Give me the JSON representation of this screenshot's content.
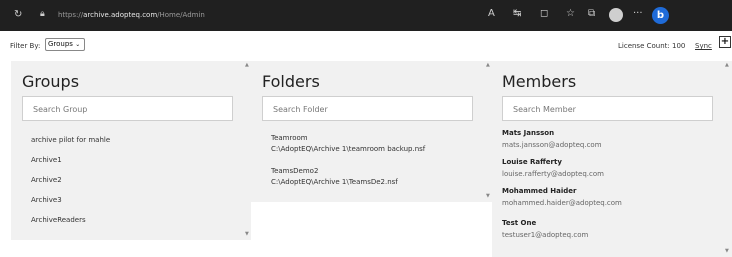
{
  "browser": {
    "url_prefix": "https://",
    "url_host": "archive.adopteq.com",
    "url_path": "/Home/Admin",
    "bing_label": "b"
  },
  "toolbar": {
    "filter_label": "Filter By:",
    "filter_value": "Groups",
    "license_text": "License Count: 100",
    "sync_label": "Sync",
    "add_label": "+"
  },
  "groups": {
    "title": "Groups",
    "search_placeholder": "Search Group",
    "items": [
      "archive pilot for mahle",
      "Archive1",
      "Archive2",
      "Archive3",
      "ArchiveReaders"
    ]
  },
  "folders": {
    "title": "Folders",
    "search_placeholder": "Search Folder",
    "items": [
      {
        "name": "Teamroom",
        "path": "C:\\AdoptEQ\\Archive 1\\teamroom backup.nsf"
      },
      {
        "name": "TeamsDemo2",
        "path": "C:\\AdoptEQ\\Archive 1\\TeamsDe2.nsf"
      }
    ]
  },
  "members": {
    "title": "Members",
    "search_placeholder": "Search Member",
    "items": [
      {
        "name": "Mats Jansson",
        "email": "mats.jansson@adopteq.com"
      },
      {
        "name": "Louise Rafferty",
        "email": "louise.rafferty@adopteq.com"
      },
      {
        "name": "Mohammed Haider",
        "email": "mohammed.haider@adopteq.com"
      },
      {
        "name": "Test One",
        "email": "testuser1@adopteq.com"
      }
    ]
  }
}
